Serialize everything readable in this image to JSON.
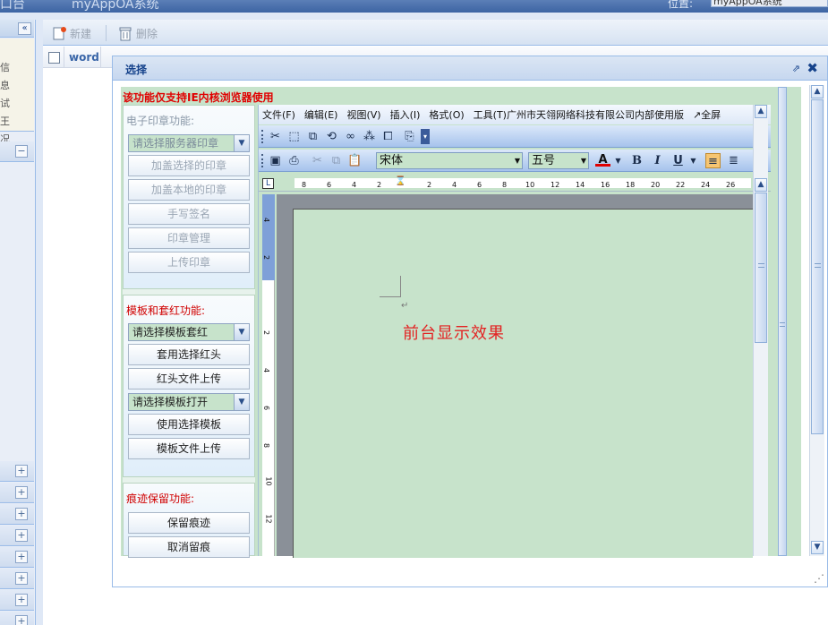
{
  "header": {
    "title_left": "口台",
    "title": "myAppOA系统",
    "location_label": "位置:",
    "location_value": "myAppOA系统"
  },
  "sidebar": {
    "collapse_glyph": "«",
    "menu_fragments": [
      "信",
      "息",
      "试",
      "王",
      "况"
    ],
    "minus_glyph": "−",
    "plus_glyph": "+"
  },
  "toolbar": {
    "new_label": "新建",
    "delete_label": "删除"
  },
  "grid": {
    "column": "word"
  },
  "dialog": {
    "title": "选择",
    "max_glyph": "⇗",
    "close_glyph": "✖",
    "warning": "该功能仅支持IE内核浏览器使用",
    "seal_section": {
      "title": "电子印章功能:",
      "select_placeholder": "请选择服务器印章",
      "buttons": [
        "加盖选择的印章",
        "加盖本地的印章",
        "手写签名",
        "印章管理",
        "上传印章"
      ]
    },
    "template_section": {
      "title": "模板和套红功能:",
      "select_redhead": "请选择模板套红",
      "btn_apply_redhead": "套用选择红头",
      "btn_upload_redhead": "红头文件上传",
      "select_template": "请选择模板打开",
      "btn_use_template": "使用选择模板",
      "btn_upload_template": "模板文件上传"
    },
    "trace_section": {
      "title": "痕迹保留功能:",
      "btn_keep": "保留痕迹",
      "btn_cancel": "取消留痕"
    }
  },
  "office": {
    "menu": [
      "文件(F)",
      "编辑(E)",
      "视图(V)",
      "插入(I)",
      "格式(O)",
      "工具(T)"
    ],
    "license": "广州市天翎网络科技有限公司内部使用版",
    "fullscreen": "↗全屏",
    "font_name": "宋体",
    "font_size": "五号",
    "ruler_corner": "L",
    "ruler_h_left": [
      "8",
      "6",
      "4",
      "2"
    ],
    "ruler_h_right": [
      "2",
      "4",
      "6",
      "8",
      "10",
      "12",
      "14",
      "16",
      "18",
      "20",
      "22",
      "24",
      "26"
    ],
    "ruler_v": [
      "4",
      "2",
      "2",
      "4",
      "6",
      "8",
      "10",
      "12"
    ],
    "para_mark": "↵",
    "doc_text": "前台显示效果"
  }
}
